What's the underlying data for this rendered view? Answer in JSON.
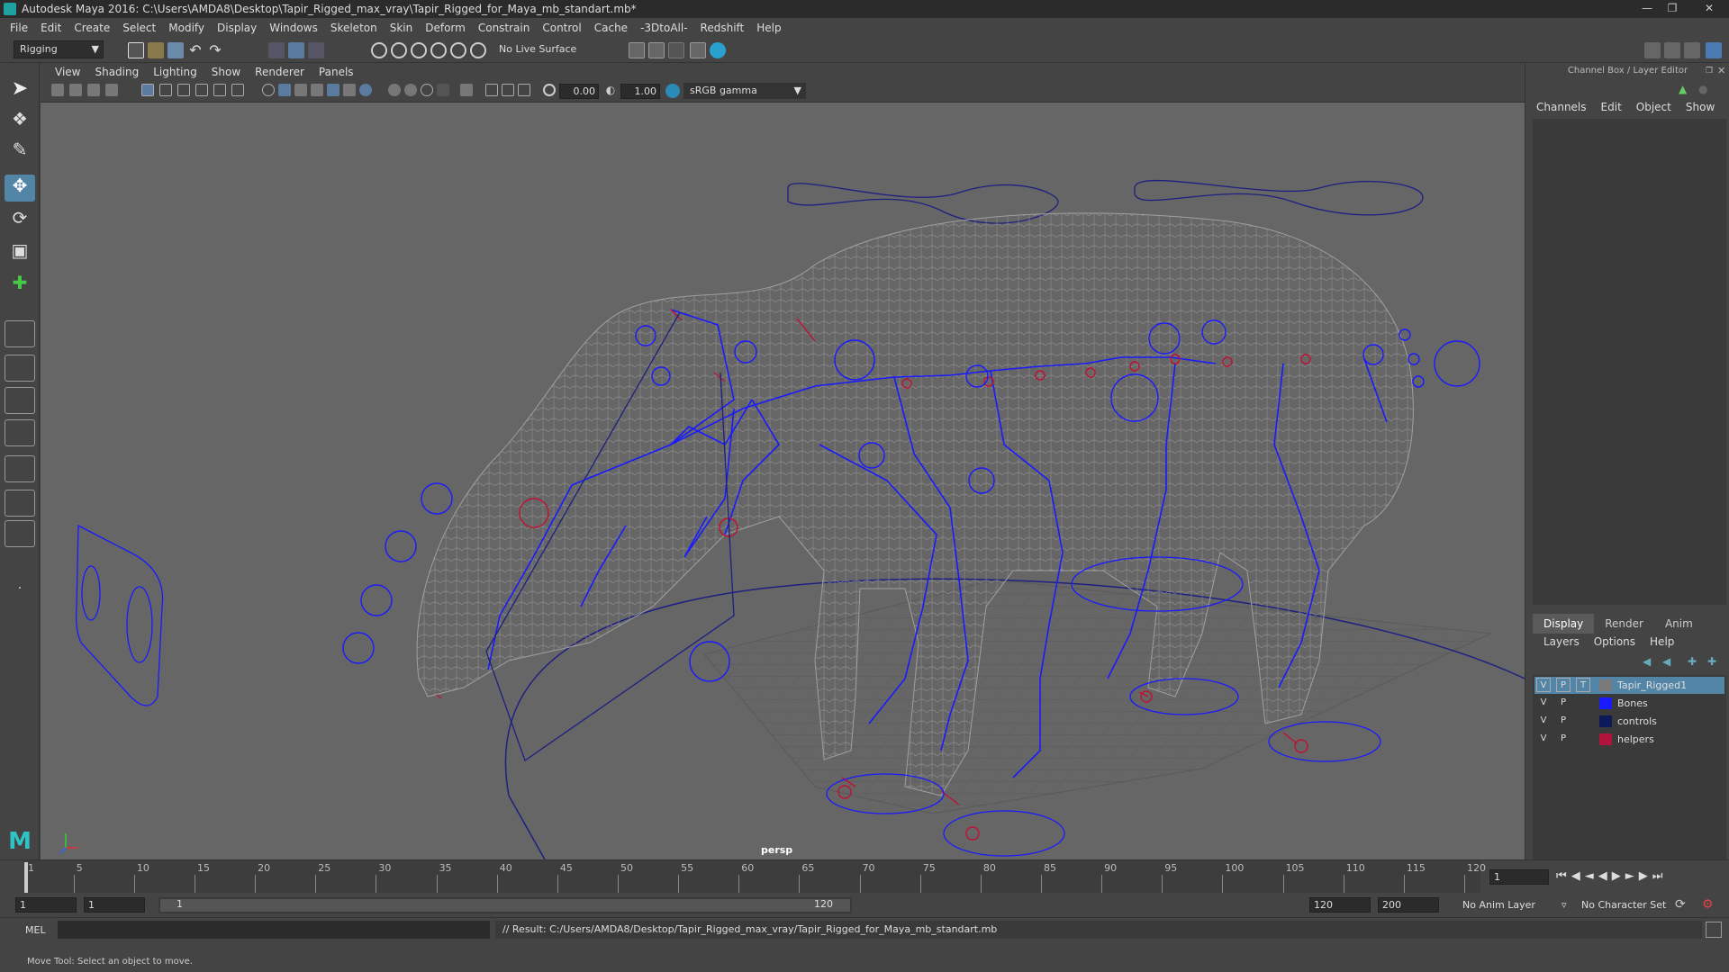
{
  "window": {
    "title": "Autodesk Maya 2016: C:\\Users\\AMDA8\\Desktop\\Tapir_Rigged_max_vray\\Tapir_Rigged_for_Maya_mb_standart.mb*"
  },
  "menubar": [
    "File",
    "Edit",
    "Create",
    "Select",
    "Modify",
    "Display",
    "Windows",
    "Skeleton",
    "Skin",
    "Deform",
    "Constrain",
    "Control",
    "Cache",
    "-3DtoAll-",
    "Redshift",
    "Help"
  ],
  "statusline": {
    "menuset": "Rigging",
    "live_surface": "No Live Surface"
  },
  "viewport": {
    "menu": [
      "View",
      "Shading",
      "Lighting",
      "Show",
      "Renderer",
      "Panels"
    ],
    "exposure": "0.00",
    "gamma": "1.00",
    "colorspace": "sRGB gamma",
    "camera_label": "persp"
  },
  "channelbox": {
    "title": "Channel Box / Layer Editor",
    "menu": [
      "Channels",
      "Edit",
      "Object",
      "Show"
    ]
  },
  "layer_editor": {
    "tabs": [
      "Display",
      "Render",
      "Anim"
    ],
    "menu": [
      "Layers",
      "Options",
      "Help"
    ],
    "layers": [
      {
        "v": "V",
        "p": "P",
        "t": "T",
        "name": "Tapir_Rigged1",
        "color": "#7a7a7a",
        "selected": true
      },
      {
        "v": "V",
        "p": "P",
        "t": "",
        "name": "Bones",
        "color": "#1a1aff",
        "selected": false
      },
      {
        "v": "V",
        "p": "P",
        "t": "",
        "name": "controls",
        "color": "#0d1a5a",
        "selected": false
      },
      {
        "v": "V",
        "p": "P",
        "t": "",
        "name": "helpers",
        "color": "#b0143c",
        "selected": false
      }
    ]
  },
  "timeline": {
    "ticks": [
      "1",
      "5",
      "10",
      "15",
      "20",
      "25",
      "30",
      "35",
      "40",
      "45",
      "50",
      "55",
      "60",
      "65",
      "70",
      "75",
      "80",
      "85",
      "90",
      "95",
      "100",
      "105",
      "110",
      "115",
      "120"
    ],
    "current_frame": "1"
  },
  "range": {
    "start": "1",
    "playback_start": "1",
    "slider_start": "1",
    "slider_end": "120",
    "playback_end": "120",
    "end": "200",
    "anim_layer": "No Anim Layer",
    "character_set": "No Character Set"
  },
  "command": {
    "lang": "MEL",
    "result": "// Result: C:/Users/AMDA8/Desktop/Tapir_Rigged_max_vray/Tapir_Rigged_for_Maya_mb_standart.mb"
  },
  "helpline": "Move Tool: Select an object to move."
}
